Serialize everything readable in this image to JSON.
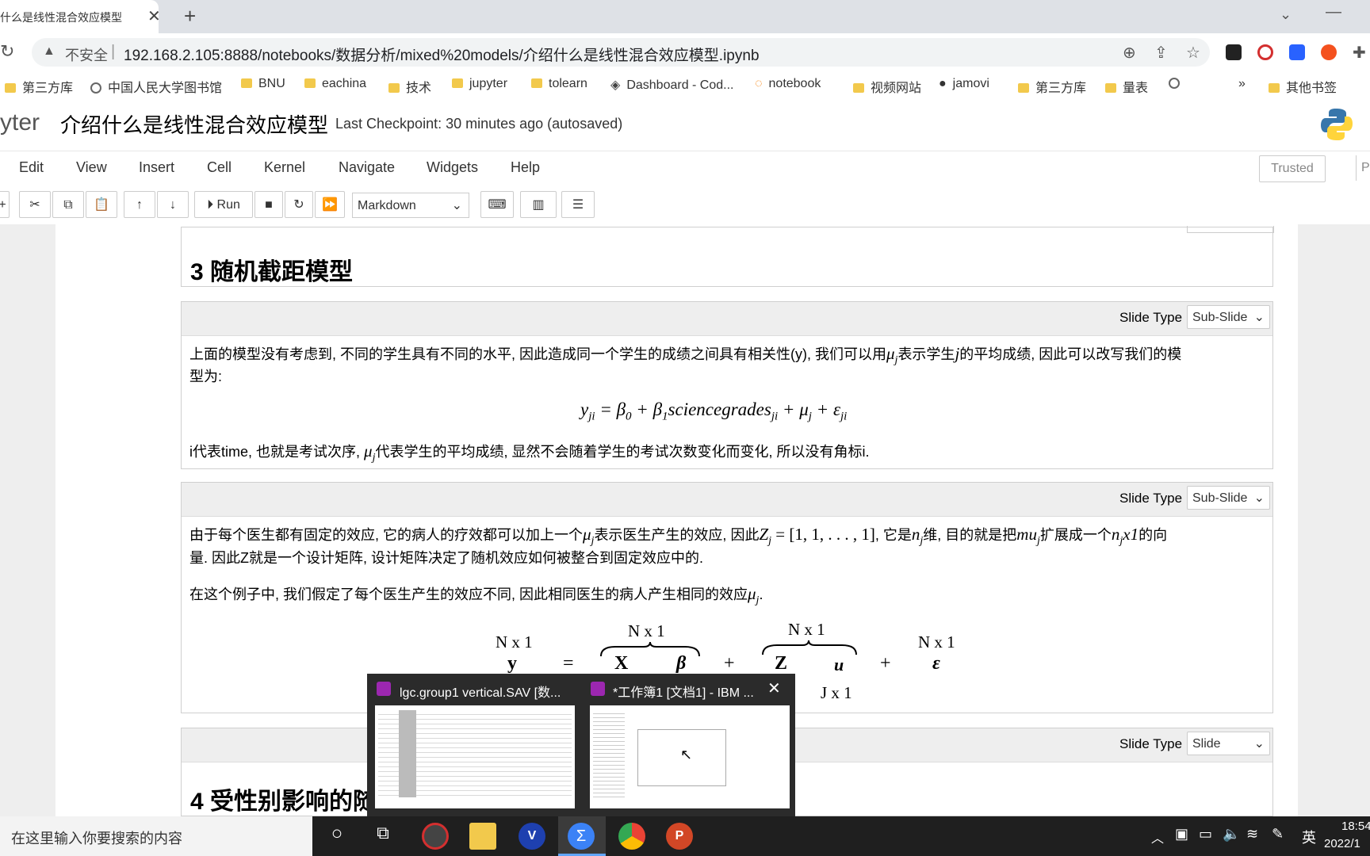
{
  "browser": {
    "tab_title": "什么是线性混合效应模型",
    "tab_close": "✕",
    "new_tab": "+",
    "security_label": "不安全",
    "url": "192.168.2.105:8888/notebooks/数据分析/mixed%20models/介绍什么是线性混合效应模型.ipynb",
    "bookmarks": [
      {
        "label": "第三方库",
        "icon": "folder-icon"
      },
      {
        "label": "中国人民大学图书馆",
        "icon": "globe-icon"
      },
      {
        "label": "BNU",
        "icon": "folder-icon"
      },
      {
        "label": "eachina",
        "icon": "folder-icon"
      },
      {
        "label": "技术",
        "icon": "folder-icon"
      },
      {
        "label": "jupyter",
        "icon": "folder-icon"
      },
      {
        "label": "tolearn",
        "icon": "folder-icon"
      },
      {
        "label": "Dashboard - Cod...",
        "icon": "codesandbox-icon"
      },
      {
        "label": "notebook",
        "icon": "jupyter-icon"
      },
      {
        "label": "视频网站",
        "icon": "folder-icon"
      },
      {
        "label": "jamovi",
        "icon": "github-icon"
      },
      {
        "label": "第三方库",
        "icon": "folder-icon"
      },
      {
        "label": "量表",
        "icon": "folder-icon"
      }
    ],
    "more_bookmarks": "»",
    "other_bookmarks": "其他书签"
  },
  "jupyter": {
    "logo_text": "yter",
    "notebook_title": "介绍什么是线性混合效应模型",
    "checkpoint": "Last Checkpoint: 30 minutes ago   (autosaved)",
    "menu": [
      "Edit",
      "View",
      "Insert",
      "Cell",
      "Kernel",
      "Navigate",
      "Widgets",
      "Help"
    ],
    "trusted": "Trusted",
    "run_label": "Run",
    "cell_type": "Markdown"
  },
  "cells": {
    "heading3": "3  随机截距模型",
    "slide_type_label": "Slide Type",
    "cell1": {
      "slide_type": "Sub-Slide",
      "p1_a": "上面的模型没有考虑到, 不同的学生具有不同的水平, 因此造成同一个学生的成绩之间具有相关性(y), 我们可以用",
      "p1_b": "表示学生",
      "p1_c": "的平均成绩, 因此可以改写我们的模",
      "p1_line2": "型为:",
      "eq": "y_ji = β_0 + β_1 sciencegrades_ji + μ_j + ε_ji",
      "p2_a": "i代表time, 也就是考试次序, ",
      "p2_b": "代表学生的平均成绩, 显然不会随着学生的考试次数变化而变化, 所以没有角标i."
    },
    "cell2": {
      "slide_type": "Sub-Slide",
      "p1_a": "由于每个医生都有固定的效应, 它的病人的疗效都可以加上一个",
      "p1_b": "表示医生产生的效应, 因此",
      "p1_c": ", 它是",
      "p1_d": "维, 目的就是把",
      "p1_e": "扩展成一个",
      "p1_f": "的向",
      "p1_line2": "量. 因此Z就是一个设计矩阵, 设计矩阵决定了随机效应如何被整合到固定效应中的.",
      "p2_a": "在这个例子中, 我们假定了每个医生产生的效应不同, 因此相同医生的病人产生相同的效应",
      "p2_b": ".",
      "diagram": {
        "dim_n1": "N x 1",
        "dim_j1": "J x 1",
        "y": "y",
        "X": "X",
        "beta": "β",
        "Z": "Z",
        "u": "u",
        "eps": "ε",
        "eq": "=",
        "plus": "+"
      }
    },
    "cell3": {
      "slide_type": "Slide"
    },
    "heading4": "4  受性别影响的随"
  },
  "popup": {
    "item1_title": "lgc.group1 vertical.SAV [数...",
    "item2_title": "*工作簿1 [文档1] - IBM ...",
    "close": "✕"
  },
  "taskbar": {
    "search_placeholder": "在这里输入你要搜索的内容",
    "lang": "英",
    "time": "18:54",
    "date": "2022/1"
  }
}
